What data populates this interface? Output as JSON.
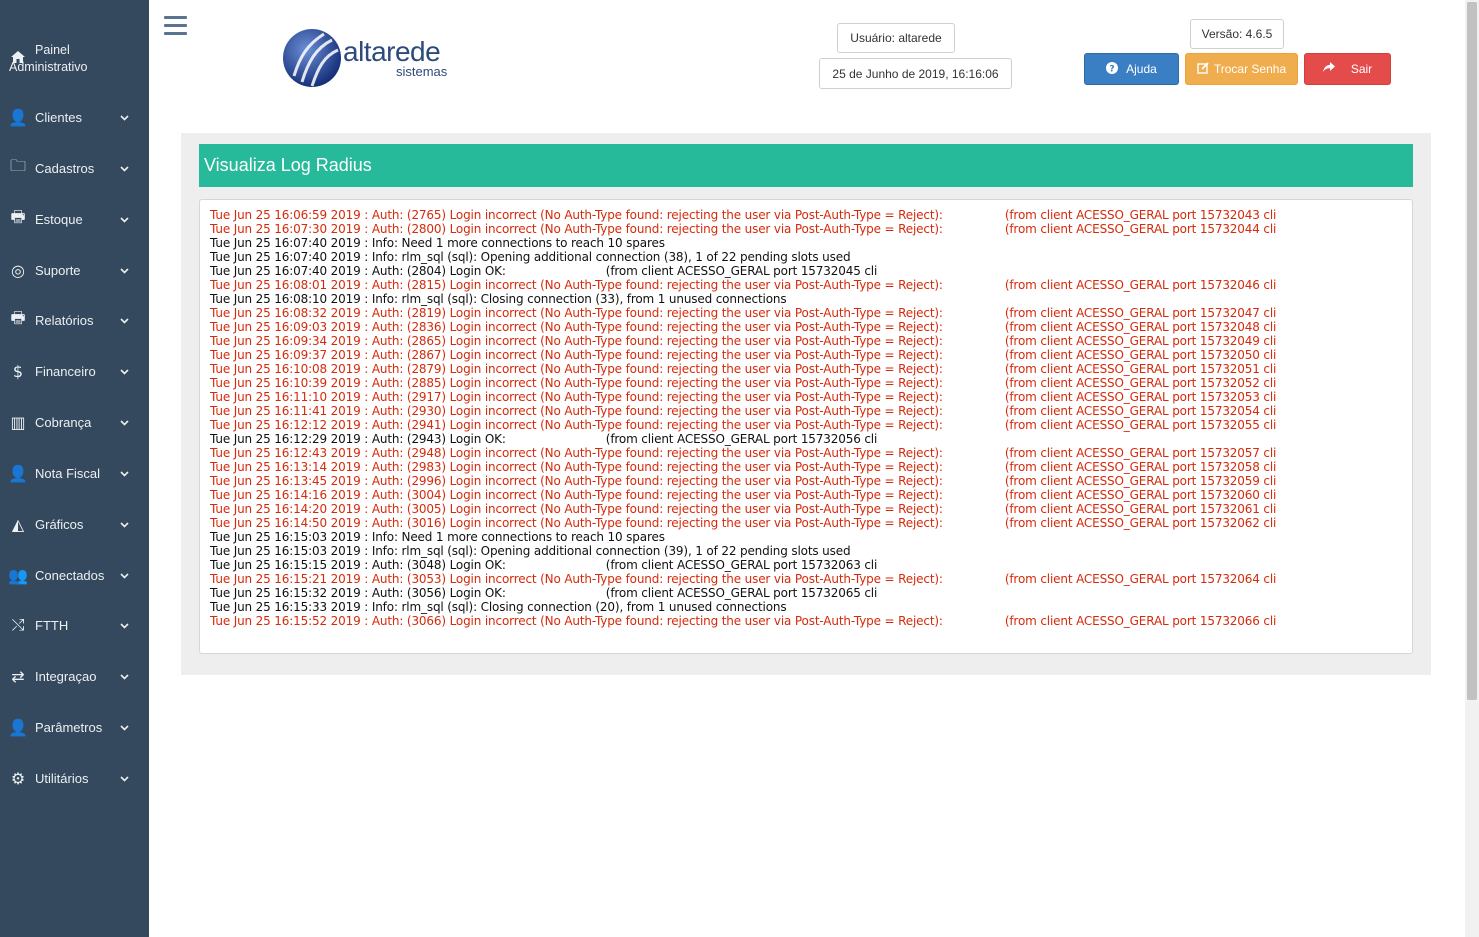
{
  "sidebar": {
    "home": {
      "label_line1": "Painel",
      "label_line2": "Administrativo",
      "icon": "home-icon"
    },
    "items": [
      {
        "label": "Clientes",
        "icon": "user-icon",
        "glyph": "👤"
      },
      {
        "label": "Cadastros",
        "icon": "folder-icon",
        "glyph": "🗀"
      },
      {
        "label": "Estoque",
        "icon": "print-icon",
        "glyph": "🖶"
      },
      {
        "label": "Suporte",
        "icon": "lifebuoy-icon",
        "glyph": "◎"
      },
      {
        "label": "Relatórios",
        "icon": "print-icon",
        "glyph": "🖶"
      },
      {
        "label": "Financeiro",
        "icon": "dollar-icon",
        "glyph": "$"
      },
      {
        "label": "Cobrança",
        "icon": "barcode-icon",
        "glyph": "▥"
      },
      {
        "label": "Nota Fiscal",
        "icon": "user-icon",
        "glyph": "👤"
      },
      {
        "label": "Gráficos",
        "icon": "area-chart-icon",
        "glyph": "◭"
      },
      {
        "label": "Conectados",
        "icon": "users-icon",
        "glyph": "👥"
      },
      {
        "label": "FTTH",
        "icon": "random-icon",
        "glyph": "⤭"
      },
      {
        "label": "Integraçao",
        "icon": "retweet-icon",
        "glyph": "⇄"
      },
      {
        "label": "Parâmetros",
        "icon": "user-icon",
        "glyph": "👤"
      },
      {
        "label": "Utilitários",
        "icon": "cogs-icon",
        "glyph": "⚙"
      }
    ],
    "chevron": "⌄"
  },
  "header": {
    "logo_text": "altarede",
    "logo_sub": "sistemas",
    "user": "Usuário: altarede",
    "datetime": "25 de Junho de 2019, 16:16:06",
    "version": "Versão: 4.6.5",
    "help_label": "Ajuda",
    "help_icon": "question-circle-icon",
    "change_password_label": "Trocar Senha",
    "change_password_icon": "edit-icon",
    "exit_label": "Sair",
    "exit_icon": "share-arrow-icon"
  },
  "page": {
    "title": "Visualiza Log Radius"
  },
  "colors": {
    "sidebar": "#34495e",
    "title_bar": "#26b99a",
    "error_text": "#d62a0c",
    "help": "#3a7fc4",
    "change_password": "#f0ad4e",
    "exit": "#e44b4b"
  },
  "log": [
    {
      "type": "err",
      "text": "Tue Jun 25 16:06:59 2019 : Auth: (2765) Login incorrect (No Auth-Type found: rejecting the user via Post-Auth-Type = Reject):",
      "rest": "(from client ACESSO_GERAL port 15732043 cli"
    },
    {
      "type": "err",
      "text": "Tue Jun 25 16:07:30 2019 : Auth: (2800) Login incorrect (No Auth-Type found: rejecting the user via Post-Auth-Type = Reject):",
      "rest": "(from client ACESSO_GERAL port 15732044 cli"
    },
    {
      "type": "ok",
      "text": "Tue Jun 25 16:07:40 2019 : Info: Need 1 more connections to reach 10 spares",
      "rest": ""
    },
    {
      "type": "ok",
      "text": "Tue Jun 25 16:07:40 2019 : Info: rlm_sql (sql): Opening additional connection (38), 1 of 22 pending slots used",
      "rest": ""
    },
    {
      "type": "ok",
      "text": "Tue Jun 25 16:07:40 2019 : Auth: (2804) Login OK:",
      "rest": "(from client ACESSO_GERAL port 15732045 cli"
    },
    {
      "type": "err",
      "text": "Tue Jun 25 16:08:01 2019 : Auth: (2815) Login incorrect (No Auth-Type found: rejecting the user via Post-Auth-Type = Reject):",
      "rest": "(from client ACESSO_GERAL port 15732046 cli"
    },
    {
      "type": "ok",
      "text": "Tue Jun 25 16:08:10 2019 : Info: rlm_sql (sql): Closing connection (33), from 1 unused connections",
      "rest": ""
    },
    {
      "type": "err",
      "text": "Tue Jun 25 16:08:32 2019 : Auth: (2819) Login incorrect (No Auth-Type found: rejecting the user via Post-Auth-Type = Reject):",
      "rest": "(from client ACESSO_GERAL port 15732047 cli"
    },
    {
      "type": "err",
      "text": "Tue Jun 25 16:09:03 2019 : Auth: (2836) Login incorrect (No Auth-Type found: rejecting the user via Post-Auth-Type = Reject):",
      "rest": "(from client ACESSO_GERAL port 15732048 cli"
    },
    {
      "type": "err",
      "text": "Tue Jun 25 16:09:34 2019 : Auth: (2865) Login incorrect (No Auth-Type found: rejecting the user via Post-Auth-Type = Reject):",
      "rest": "(from client ACESSO_GERAL port 15732049 cli"
    },
    {
      "type": "err",
      "text": "Tue Jun 25 16:09:37 2019 : Auth: (2867) Login incorrect (No Auth-Type found: rejecting the user via Post-Auth-Type = Reject):",
      "rest": "(from client ACESSO_GERAL port 15732050 cli"
    },
    {
      "type": "err",
      "text": "Tue Jun 25 16:10:08 2019 : Auth: (2879) Login incorrect (No Auth-Type found: rejecting the user via Post-Auth-Type = Reject):",
      "rest": "(from client ACESSO_GERAL port 15732051 cli"
    },
    {
      "type": "err",
      "text": "Tue Jun 25 16:10:39 2019 : Auth: (2885) Login incorrect (No Auth-Type found: rejecting the user via Post-Auth-Type = Reject):",
      "rest": "(from client ACESSO_GERAL port 15732052 cli"
    },
    {
      "type": "err",
      "text": "Tue Jun 25 16:11:10 2019 : Auth: (2917) Login incorrect (No Auth-Type found: rejecting the user via Post-Auth-Type = Reject):",
      "rest": "(from client ACESSO_GERAL port 15732053 cli"
    },
    {
      "type": "err",
      "text": "Tue Jun 25 16:11:41 2019 : Auth: (2930) Login incorrect (No Auth-Type found: rejecting the user via Post-Auth-Type = Reject):",
      "rest": "(from client ACESSO_GERAL port 15732054 cli"
    },
    {
      "type": "err",
      "text": "Tue Jun 25 16:12:12 2019 : Auth: (2941) Login incorrect (No Auth-Type found: rejecting the user via Post-Auth-Type = Reject):",
      "rest": "(from client ACESSO_GERAL port 15732055 cli"
    },
    {
      "type": "ok",
      "text": "Tue Jun 25 16:12:29 2019 : Auth: (2943) Login OK:",
      "rest": "(from client ACESSO_GERAL port 15732056 cli"
    },
    {
      "type": "err",
      "text": "Tue Jun 25 16:12:43 2019 : Auth: (2948) Login incorrect (No Auth-Type found: rejecting the user via Post-Auth-Type = Reject):",
      "rest": "(from client ACESSO_GERAL port 15732057 cli"
    },
    {
      "type": "err",
      "text": "Tue Jun 25 16:13:14 2019 : Auth: (2983) Login incorrect (No Auth-Type found: rejecting the user via Post-Auth-Type = Reject):",
      "rest": "(from client ACESSO_GERAL port 15732058 cli"
    },
    {
      "type": "err",
      "text": "Tue Jun 25 16:13:45 2019 : Auth: (2996) Login incorrect (No Auth-Type found: rejecting the user via Post-Auth-Type = Reject):",
      "rest": "(from client ACESSO_GERAL port 15732059 cli"
    },
    {
      "type": "err",
      "text": "Tue Jun 25 16:14:16 2019 : Auth: (3004) Login incorrect (No Auth-Type found: rejecting the user via Post-Auth-Type = Reject):",
      "rest": "(from client ACESSO_GERAL port 15732060 cli"
    },
    {
      "type": "err",
      "text": "Tue Jun 25 16:14:20 2019 : Auth: (3005) Login incorrect (No Auth-Type found: rejecting the user via Post-Auth-Type = Reject):",
      "rest": "(from client ACESSO_GERAL port 15732061 cli"
    },
    {
      "type": "err",
      "text": "Tue Jun 25 16:14:50 2019 : Auth: (3016) Login incorrect (No Auth-Type found: rejecting the user via Post-Auth-Type = Reject):",
      "rest": "(from client ACESSO_GERAL port 15732062 cli"
    },
    {
      "type": "ok",
      "text": "Tue Jun 25 16:15:03 2019 : Info: Need 1 more connections to reach 10 spares",
      "rest": ""
    },
    {
      "type": "ok",
      "text": "Tue Jun 25 16:15:03 2019 : Info: rlm_sql (sql): Opening additional connection (39), 1 of 22 pending slots used",
      "rest": ""
    },
    {
      "type": "ok",
      "text": "Tue Jun 25 16:15:15 2019 : Auth: (3048) Login OK:",
      "rest": "(from client ACESSO_GERAL port 15732063 cli"
    },
    {
      "type": "err",
      "text": "Tue Jun 25 16:15:21 2019 : Auth: (3053) Login incorrect (No Auth-Type found: rejecting the user via Post-Auth-Type = Reject):",
      "rest": "(from client ACESSO_GERAL port 15732064 cli"
    },
    {
      "type": "ok",
      "text": "Tue Jun 25 16:15:32 2019 : Auth: (3056) Login OK:",
      "rest": "(from client ACESSO_GERAL port 15732065 cli"
    },
    {
      "type": "ok",
      "text": "Tue Jun 25 16:15:33 2019 : Info: rlm_sql (sql): Closing connection (20), from 1 unused connections",
      "rest": ""
    },
    {
      "type": "err",
      "text": "Tue Jun 25 16:15:52 2019 : Auth: (3066) Login incorrect (No Auth-Type found: rejecting the user via Post-Auth-Type = Reject):",
      "rest": "(from client ACESSO_GERAL port 15732066 cli"
    }
  ]
}
